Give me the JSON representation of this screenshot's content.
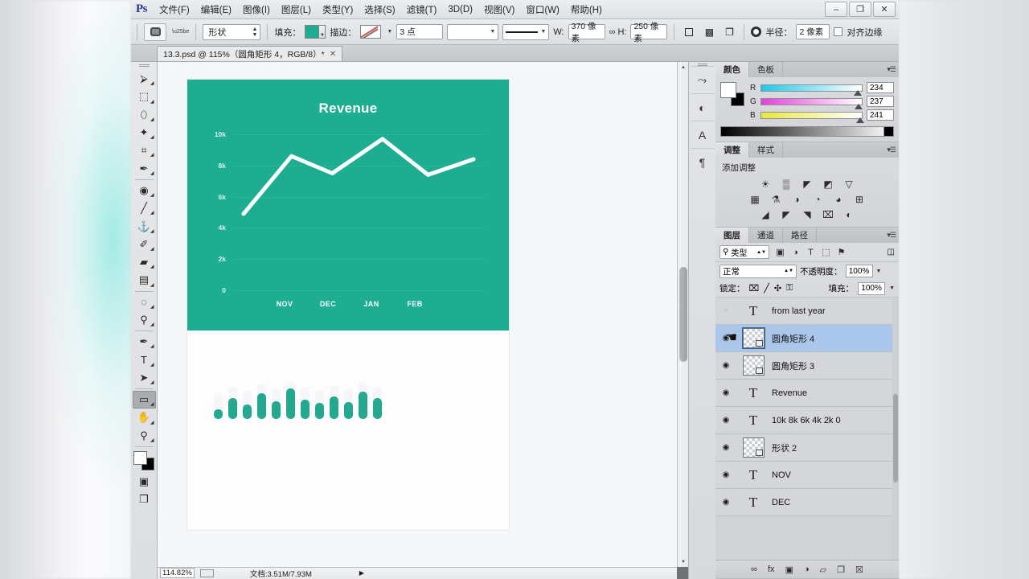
{
  "window": {
    "app_logo": "Ps",
    "minimize": "–",
    "restore": "❐",
    "close": "✕"
  },
  "menubar": [
    {
      "label": "文件(F)"
    },
    {
      "label": "编辑(E)"
    },
    {
      "label": "图像(I)"
    },
    {
      "label": "图层(L)"
    },
    {
      "label": "类型(Y)"
    },
    {
      "label": "选择(S)"
    },
    {
      "label": "滤镜(T)"
    },
    {
      "label": "3D(D)"
    },
    {
      "label": "视图(V)"
    },
    {
      "label": "窗口(W)"
    },
    {
      "label": "帮助(H)"
    }
  ],
  "options_bar": {
    "tool_preset_icon": "rounded-rectangle-icon",
    "mode_value": "形状",
    "fill_label": "填充：",
    "fill_color": "#1dae91",
    "stroke_label": "描边：",
    "stroke_width_value": "3 点",
    "width_label": "W:",
    "width_value": "370 像素",
    "link_icon": "chain-link-icon",
    "height_label": "H:",
    "height_value": "250 像素",
    "radius_label": "半径：",
    "radius_value": "2 像素",
    "align_edges_label": "对齐边缘"
  },
  "document_tab": {
    "title": "13.3.psd @ 115%（圆角矩形 4，RGB/8）*",
    "close": "✕"
  },
  "toolbox": [
    {
      "name": "move-tool",
      "glyph": "⮚"
    },
    {
      "name": "marquee-tool",
      "glyph": "⬚"
    },
    {
      "name": "lasso-tool",
      "glyph": "⬯"
    },
    {
      "name": "magic-wand-tool",
      "glyph": "✦"
    },
    {
      "name": "crop-tool",
      "glyph": "⌗"
    },
    {
      "name": "eyedropper-tool",
      "glyph": "✒"
    },
    {
      "name": "healing-brush-tool",
      "glyph": "◉"
    },
    {
      "name": "brush-tool",
      "glyph": "╱"
    },
    {
      "name": "clone-stamp-tool",
      "glyph": "⚓"
    },
    {
      "name": "history-brush-tool",
      "glyph": "✐"
    },
    {
      "name": "eraser-tool",
      "glyph": "▰"
    },
    {
      "name": "gradient-tool",
      "glyph": "▤"
    },
    {
      "name": "blur-tool",
      "glyph": "◌"
    },
    {
      "name": "dodge-tool",
      "glyph": "⚲"
    },
    {
      "name": "pen-tool",
      "glyph": "✒"
    },
    {
      "name": "type-tool",
      "glyph": "T"
    },
    {
      "name": "path-selection-tool",
      "glyph": "➤"
    },
    {
      "name": "rounded-rectangle-tool",
      "glyph": "▭",
      "active": true
    },
    {
      "name": "hand-tool",
      "glyph": "✋"
    },
    {
      "name": "zoom-tool",
      "glyph": "⚲"
    }
  ],
  "toolbox_bottom": {
    "quick_mask": "▣",
    "screen_mode": "❐"
  },
  "canvas": {
    "chart_card_color": "#1dae91",
    "artboard_bg": "#fdfdfe"
  },
  "chart_data": {
    "type": "line",
    "title": "Revenue",
    "xlabel": "",
    "ylabel": "",
    "categories": [
      "NOV",
      "DEC",
      "JAN",
      "FEB"
    ],
    "ytick_labels": [
      "10k",
      "8k",
      "6k",
      "4k",
      "2k",
      "0"
    ],
    "ylim": [
      0,
      10000
    ],
    "grid": true,
    "legend": "none",
    "line_color": "#ffffff",
    "x": [
      0,
      1,
      2,
      3,
      4,
      5,
      6,
      7
    ],
    "values": [
      4900,
      8600,
      7500,
      9700,
      7400,
      8400
    ],
    "series": [
      {
        "name": "Revenue",
        "points": [
          {
            "x": 0.0,
            "y": 4900
          },
          {
            "x": 1.0,
            "y": 8600
          },
          {
            "x": 1.85,
            "y": 7500
          },
          {
            "x": 2.9,
            "y": 9700
          },
          {
            "x": 3.85,
            "y": 7400
          },
          {
            "x": 4.8,
            "y": 8400
          }
        ]
      }
    ]
  },
  "bar_chart": {
    "type": "bar",
    "bar_color": "#22a98f",
    "ghost_color": "#f0eef6",
    "values": [
      12,
      26,
      18,
      32,
      22,
      38,
      24,
      20,
      28,
      21,
      34,
      26
    ],
    "ghost_values": [
      32,
      40,
      36,
      44,
      38,
      46,
      40,
      36,
      42,
      38,
      46,
      40
    ]
  },
  "statusbar": {
    "zoom": "114.82%",
    "doc_label": "文档:3.51M/7.93M",
    "play": "▶"
  },
  "dock_strip": [
    {
      "name": "history-icon",
      "glyph": "⤳"
    },
    {
      "name": "color-swatch-icon",
      "glyph": "◐"
    },
    {
      "name": "character-icon",
      "glyph": "A"
    },
    {
      "name": "paragraph-icon",
      "glyph": "¶"
    }
  ],
  "color_panel": {
    "tabs": [
      {
        "label": "颜色",
        "active": true
      },
      {
        "label": "色板",
        "active": false
      }
    ],
    "channels": [
      {
        "name": "R",
        "value": "234",
        "pos": 91.8
      },
      {
        "name": "G",
        "value": "237",
        "pos": 92.9
      },
      {
        "name": "B",
        "value": "241",
        "pos": 94.5
      }
    ]
  },
  "adjustments_panel": {
    "tabs": [
      {
        "label": "调整",
        "active": true
      },
      {
        "label": "样式",
        "active": false
      }
    ],
    "heading": "添加调整",
    "rows": [
      [
        "☀",
        "▒",
        "◤",
        "◩",
        "▽"
      ],
      [
        "▦",
        "⚗",
        "◑",
        "◔",
        "◕",
        "⊞"
      ],
      [
        "◢",
        "◤",
        "◥",
        "⌧",
        "◐"
      ]
    ]
  },
  "layers_panel": {
    "tabs": [
      {
        "label": "图层",
        "active": true
      },
      {
        "label": "通道",
        "active": false
      },
      {
        "label": "路径",
        "active": false
      }
    ],
    "filter_label": "类型",
    "filter_icons": [
      "▣",
      "◑",
      "T",
      "⬚",
      "⚑"
    ],
    "blend_mode": "正常",
    "opacity_label": "不透明度：",
    "opacity_value": "100%",
    "lock_label": "锁定：",
    "lock_icons": [
      "⌧",
      "╱",
      "✣",
      "⚿"
    ],
    "fill_label": "填充：",
    "fill_value": "100%",
    "layers": [
      {
        "name": "from last year",
        "type": "text",
        "visible": false,
        "selected": false
      },
      {
        "name": "圆角矩形 4",
        "type": "shape",
        "visible": true,
        "selected": true
      },
      {
        "name": "圆角矩形 3",
        "type": "shape",
        "visible": true,
        "selected": false
      },
      {
        "name": "Revenue",
        "type": "text",
        "visible": true,
        "selected": false
      },
      {
        "name": "10k 8k 6k 4k 2k 0",
        "type": "text",
        "visible": true,
        "selected": false
      },
      {
        "name": "形状 2",
        "type": "shape",
        "visible": true,
        "selected": false
      },
      {
        "name": "NOV",
        "type": "text",
        "visible": true,
        "selected": false
      },
      {
        "name": "DEC",
        "type": "text",
        "visible": true,
        "selected": false
      }
    ],
    "footer_icons": [
      "∞",
      "fx",
      "▣",
      "◑",
      "▱",
      "❐",
      "☒"
    ]
  }
}
